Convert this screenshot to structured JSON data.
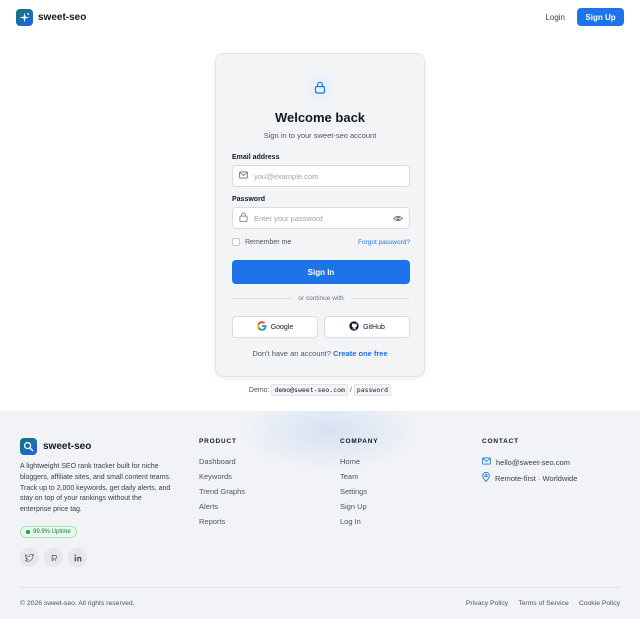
{
  "header": {
    "brand": "sweet-seo",
    "login_label": "Login",
    "signup_label": "Sign Up"
  },
  "card": {
    "title": "Welcome back",
    "subtitle": "Sign in to your sweet-seo account",
    "email_label": "Email address",
    "email_placeholder": "you@example.com",
    "password_label": "Password",
    "password_placeholder": "Enter your password",
    "remember_label": "Remember me",
    "forgot_label": "Forgot password?",
    "signin_label": "Sign In",
    "divider_text": "or continue with",
    "google_label": "Google",
    "github_label": "GitHub",
    "no_account_text": "Don't have an account?",
    "create_label": "Create one free"
  },
  "demo": {
    "prefix": "Demo:",
    "email": "demo@sweet-seo.com",
    "separator": "/",
    "password": "password"
  },
  "footer": {
    "brand": "sweet-seo",
    "description": "A lightweight SEO rank tracker built for niche bloggers, affiliate sites, and small content teams. Track up to 2,000 keywords, get daily alerts, and stay on top of your rankings without the enterprise price tag.",
    "uptime": "99.9% Uptime",
    "product": {
      "heading": "PRODUCT",
      "links": [
        "Dashboard",
        "Keywords",
        "Trend Graphs",
        "Alerts",
        "Reports"
      ]
    },
    "company": {
      "heading": "COMPANY",
      "links": [
        "Home",
        "Team",
        "Settings",
        "Sign Up",
        "Log In"
      ]
    },
    "contact": {
      "heading": "CONTACT",
      "email": "hello@sweet-seo.com",
      "location": "Remote-first · Worldwide"
    },
    "copyright": "© 2026 sweet-seo. All rights reserved.",
    "legal": [
      "Privacy Policy",
      "Terms of Service",
      "Cookie Policy"
    ]
  },
  "icons": {
    "brand": "sparkle-icon",
    "lock": "lock-icon",
    "mail": "mail-icon",
    "eye": "eye-icon",
    "google": "google-icon",
    "github": "github-icon",
    "footer_brand": "search-icon",
    "twitter": "twitter-icon",
    "github_footer": "github-icon",
    "linkedin": "linkedin-icon",
    "location": "location-pin-icon"
  },
  "colors": {
    "accent": "#1d74e8",
    "success": "#16a34a",
    "logo_start": "#0f766e",
    "logo_end": "#2563eb"
  }
}
